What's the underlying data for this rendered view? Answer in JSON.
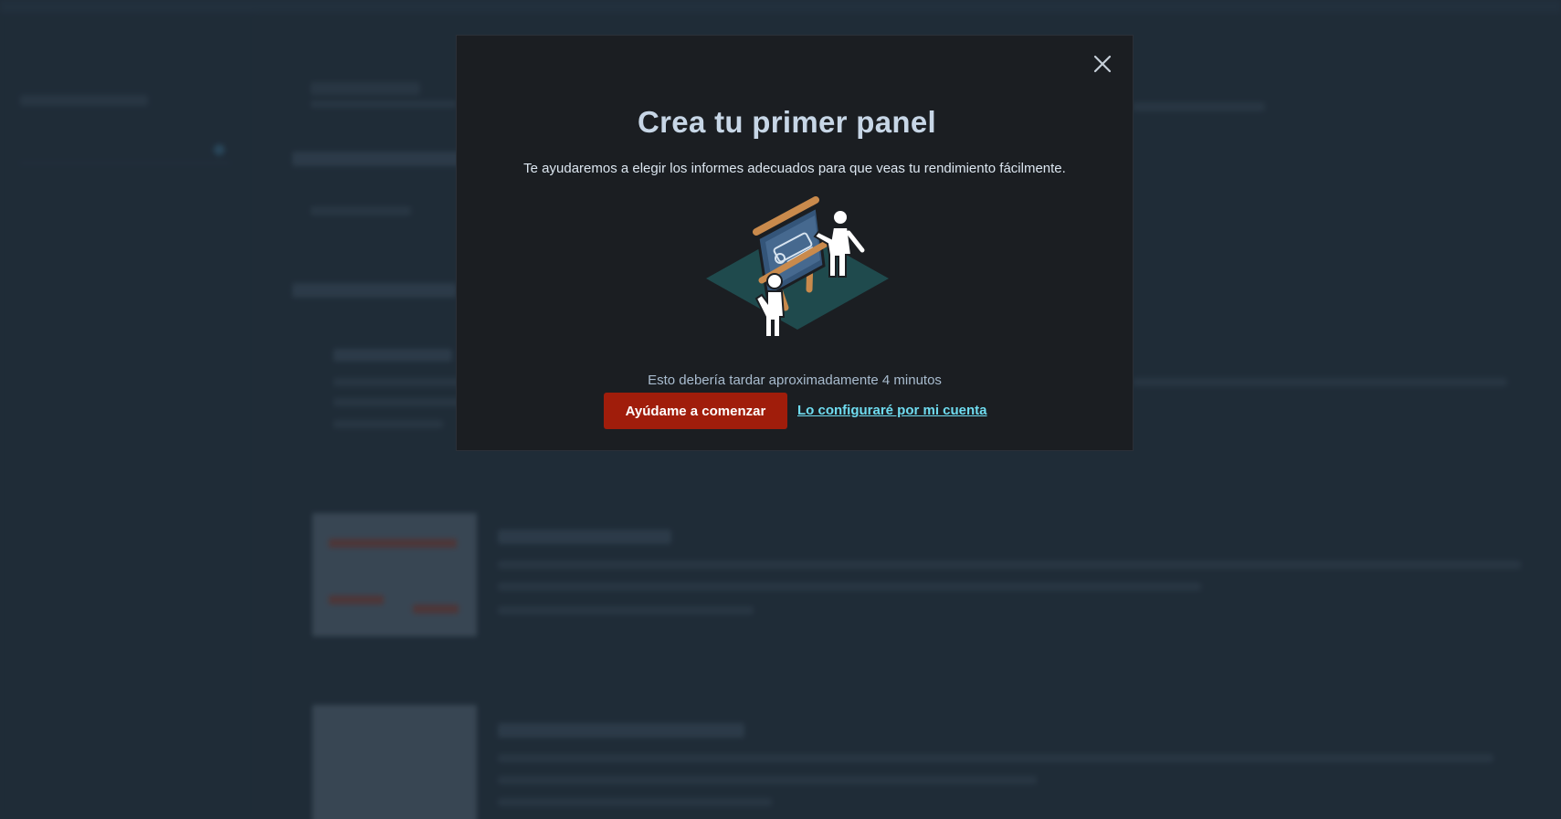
{
  "modal": {
    "title": "Crea tu primer panel",
    "subtitle": "Te ayudaremos a elegir los informes adecuados para que veas tu rendimiento fácilmente.",
    "illustration_icon": "presentation-board-icon",
    "note": "Esto debería tardar aproximadamente 4 minutos",
    "primary_button": "Ayúdame a comenzar",
    "secondary_link": "Lo configuraré por mi cuenta",
    "close_icon": "close-icon"
  },
  "colors": {
    "modal_background": "#1b1e22",
    "primary_button": "#a01d0b",
    "link": "#6fdcf0",
    "title": "#c7d6e6",
    "page_background": "#273644"
  }
}
